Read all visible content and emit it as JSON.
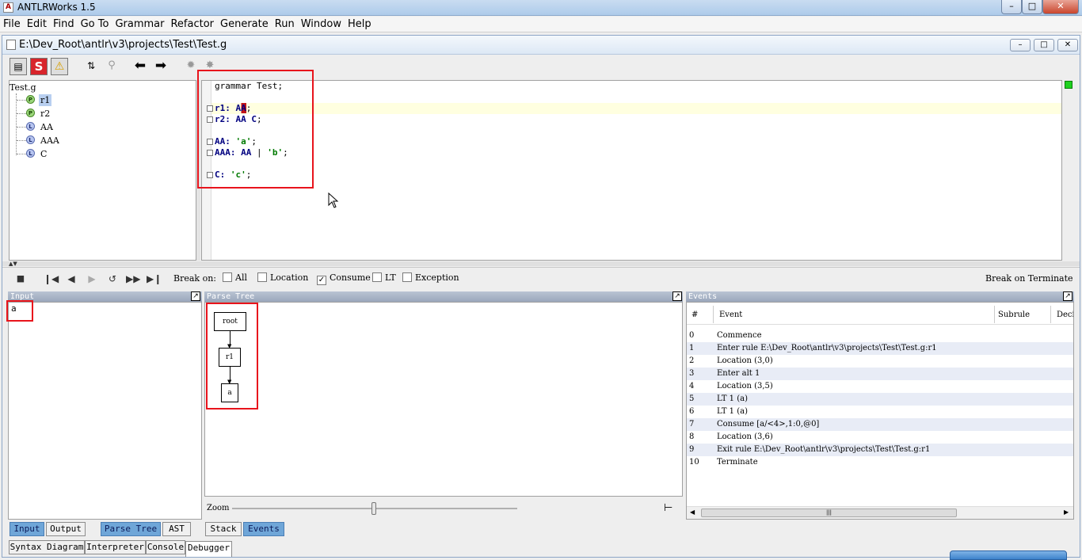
{
  "app": {
    "title": "ANTLRWorks 1.5"
  },
  "menu": [
    "File",
    "Edit",
    "Find",
    "Go To",
    "Grammar",
    "Refactor",
    "Generate",
    "Run",
    "Window",
    "Help"
  ],
  "document": {
    "path": "E:\\Dev_Root\\antlr\\v3\\projects\\Test\\Test.g"
  },
  "toolbar": {
    "s_label": "S"
  },
  "rule_tree": {
    "root": "Test.g",
    "items": [
      {
        "badge": "P",
        "name": "r1"
      },
      {
        "badge": "P",
        "name": "r2"
      },
      {
        "badge": "L",
        "name": "AA"
      },
      {
        "badge": "L",
        "name": "AAA"
      },
      {
        "badge": "L",
        "name": "C"
      }
    ]
  },
  "code": {
    "line1": "grammar Test;",
    "r1": {
      "name": "r1:",
      "ref": "AA",
      "end": ";"
    },
    "r2": {
      "name": "r2:",
      "refs": "AA C",
      "end": ";"
    },
    "aa": {
      "name": "AA:",
      "lit": "'a'",
      "end": ";"
    },
    "aaa": {
      "name": "AAA:",
      "ref": "AA",
      "sep": "|",
      "lit": "'b'",
      "end": ";"
    },
    "c": {
      "name": "C:",
      "lit": "'c'",
      "end": ";"
    }
  },
  "debugger": {
    "break_on": "Break on:",
    "options": [
      {
        "label": "All",
        "checked": false
      },
      {
        "label": "Location",
        "checked": false
      },
      {
        "label": "Consume",
        "checked": true
      },
      {
        "label": "LT",
        "checked": false
      },
      {
        "label": "Exception",
        "checked": false
      }
    ],
    "break_on_terminate": "Break on Terminate"
  },
  "input_panel": {
    "header": "Input",
    "value": "a"
  },
  "parse_tree_panel": {
    "header": "Parse Tree",
    "nodes": [
      "root",
      "r1",
      "a"
    ],
    "zoom_label": "Zoom"
  },
  "events_panel": {
    "header": "Events",
    "columns": [
      "#",
      "Event",
      "Subrule",
      "Deci"
    ],
    "rows": [
      {
        "n": "0",
        "event": "Commence"
      },
      {
        "n": "1",
        "event": "Enter rule E:\\Dev_Root\\antlr\\v3\\projects\\Test\\Test.g:r1"
      },
      {
        "n": "2",
        "event": "Location (3,0)"
      },
      {
        "n": "3",
        "event": "Enter alt 1"
      },
      {
        "n": "4",
        "event": "Location (3,5)"
      },
      {
        "n": "5",
        "event": "LT 1 (a)"
      },
      {
        "n": "6",
        "event": "LT 1 (a)"
      },
      {
        "n": "7",
        "event": "Consume [a/<4>,1:0,@0]"
      },
      {
        "n": "8",
        "event": "Location (3,6)"
      },
      {
        "n": "9",
        "event": "Exit rule E:\\Dev_Root\\antlr\\v3\\projects\\Test\\Test.g:r1"
      },
      {
        "n": "10",
        "event": "Terminate"
      }
    ]
  },
  "panel_tabs": {
    "input": "Input",
    "output": "Output",
    "parse_tree": "Parse Tree",
    "ast": "AST",
    "stack": "Stack",
    "events": "Events"
  },
  "bottom_tabs": [
    "Syntax Diagram",
    "Interpreter",
    "Console",
    "Debugger"
  ],
  "colors": {
    "highlight_box": "#e8141c",
    "selected_tab": "#6fa6d8",
    "current_line": "#ffffe0"
  }
}
